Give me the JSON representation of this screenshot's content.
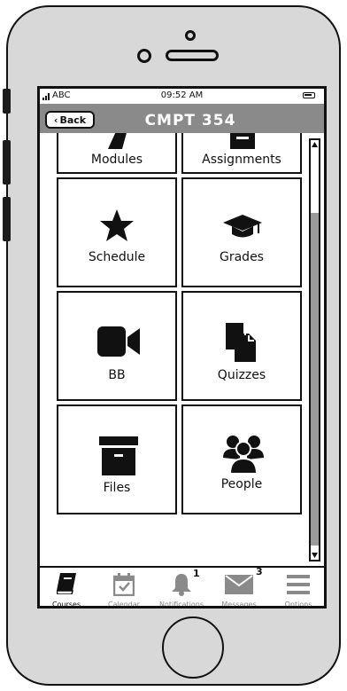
{
  "status": {
    "carrier": "ABC",
    "time": "09:52 AM"
  },
  "nav": {
    "back_label": "Back",
    "title": "CMPT 354"
  },
  "tiles": [
    {
      "label": "Modules",
      "icon": "modules-icon"
    },
    {
      "label": "Assignments",
      "icon": "assignments-icon"
    },
    {
      "label": "Schedule",
      "icon": "star-icon"
    },
    {
      "label": "Grades",
      "icon": "graduation-cap-icon"
    },
    {
      "label": "BB",
      "icon": "video-camera-icon"
    },
    {
      "label": "Quizzes",
      "icon": "documents-icon"
    },
    {
      "label": "Files",
      "icon": "archive-box-icon"
    },
    {
      "label": "People",
      "icon": "people-icon"
    }
  ],
  "tabs": [
    {
      "label": "Courses",
      "icon": "book-icon",
      "active": true
    },
    {
      "label": "Calendar",
      "icon": "calendar-icon"
    },
    {
      "label": "Notifications",
      "icon": "bell-icon",
      "badge": "1"
    },
    {
      "label": "Messages",
      "icon": "envelope-icon",
      "badge": "3"
    },
    {
      "label": "Options",
      "icon": "menu-icon"
    }
  ],
  "colors": {
    "navbar": "#8a8a8a",
    "phone": "#d8d8d8",
    "scroll_thumb": "#9a9a9a"
  }
}
